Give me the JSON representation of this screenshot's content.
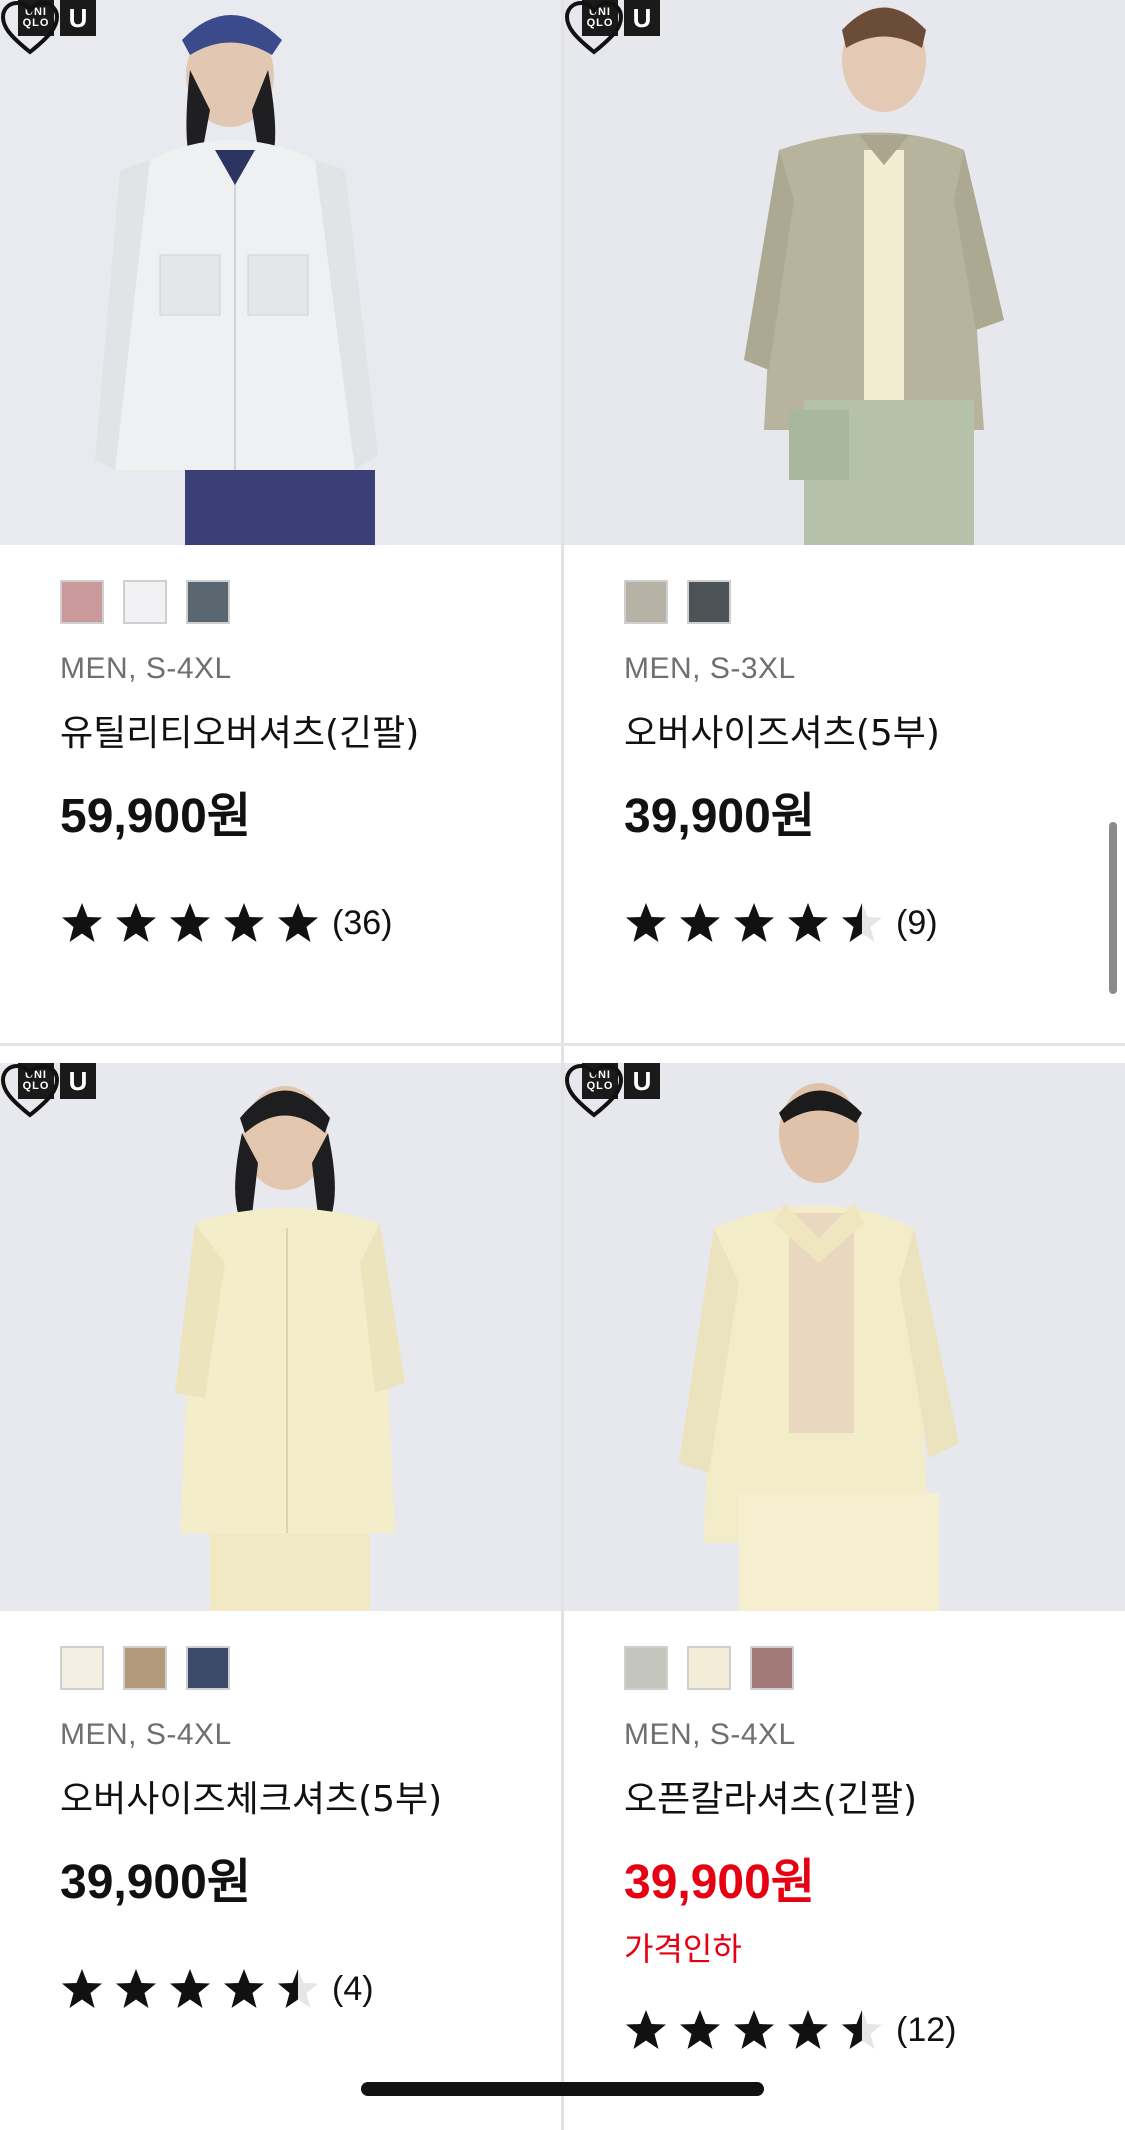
{
  "brand": {
    "logo_text": "UNI\nQLO",
    "logo_u": "U"
  },
  "products": [
    {
      "swatches": [
        "#c9999b",
        "#f2f2f4",
        "#5a6670"
      ],
      "meta": "MEN, S-4XL",
      "name": "유틸리티오버셔츠(긴팔)",
      "price": "59,900원",
      "price_red": false,
      "badge": "",
      "rating": 5,
      "count": "(36)",
      "image_desc": "white utility overshirt"
    },
    {
      "swatches": [
        "#b6b2a6",
        "#4b5357"
      ],
      "meta": "MEN, S-3XL",
      "name": "오버사이즈셔츠(5부)",
      "price": "39,900원",
      "price_red": false,
      "badge": "",
      "rating": 4.5,
      "count": "(9)",
      "image_desc": "khaki oversized shirt"
    },
    {
      "swatches": [
        "#f4efe2",
        "#b29a7a",
        "#3e4a6a"
      ],
      "meta": "MEN, S-4XL",
      "name": "오버사이즈체크셔츠(5부)",
      "price": "39,900원",
      "price_red": false,
      "badge": "",
      "rating": 4.5,
      "count": "(4)",
      "image_desc": "cream check shirt"
    },
    {
      "swatches": [
        "#c3c5bd",
        "#f3ecd6",
        "#a27b78"
      ],
      "meta": "MEN, S-4XL",
      "name": "오픈칼라셔츠(긴팔)",
      "price": "39,900원",
      "price_red": true,
      "badge": "가격인하",
      "rating": 4.5,
      "count": "(12)",
      "image_desc": "cream open collar shirt"
    }
  ],
  "colors": {
    "sale_red": "#e60012",
    "text": "#111111",
    "meta_gray": "#6f6f6f"
  }
}
